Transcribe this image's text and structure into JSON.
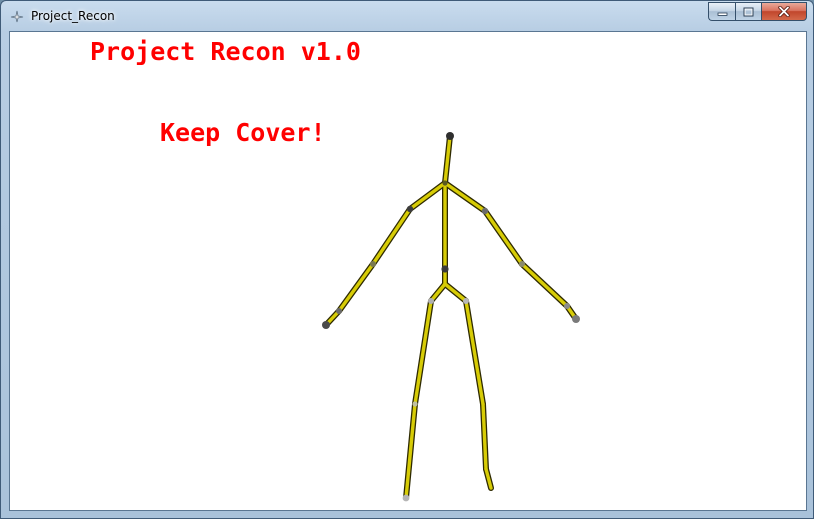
{
  "window": {
    "title": "Project_Recon",
    "icon": "app-sparkle-icon",
    "controls": [
      "minimize-icon",
      "maximize-icon",
      "close-icon"
    ]
  },
  "game": {
    "title": "Project Recon v1.0",
    "status": "Keep Cover!",
    "text_color": "#ff0000",
    "background": "#ffffff"
  },
  "skeleton": {
    "bone_color": "#d7cc06",
    "bone_outline": "#2e2a00",
    "joint_color_dark": "#3c3c3c",
    "joint_color_light": "#b0b0b0"
  }
}
